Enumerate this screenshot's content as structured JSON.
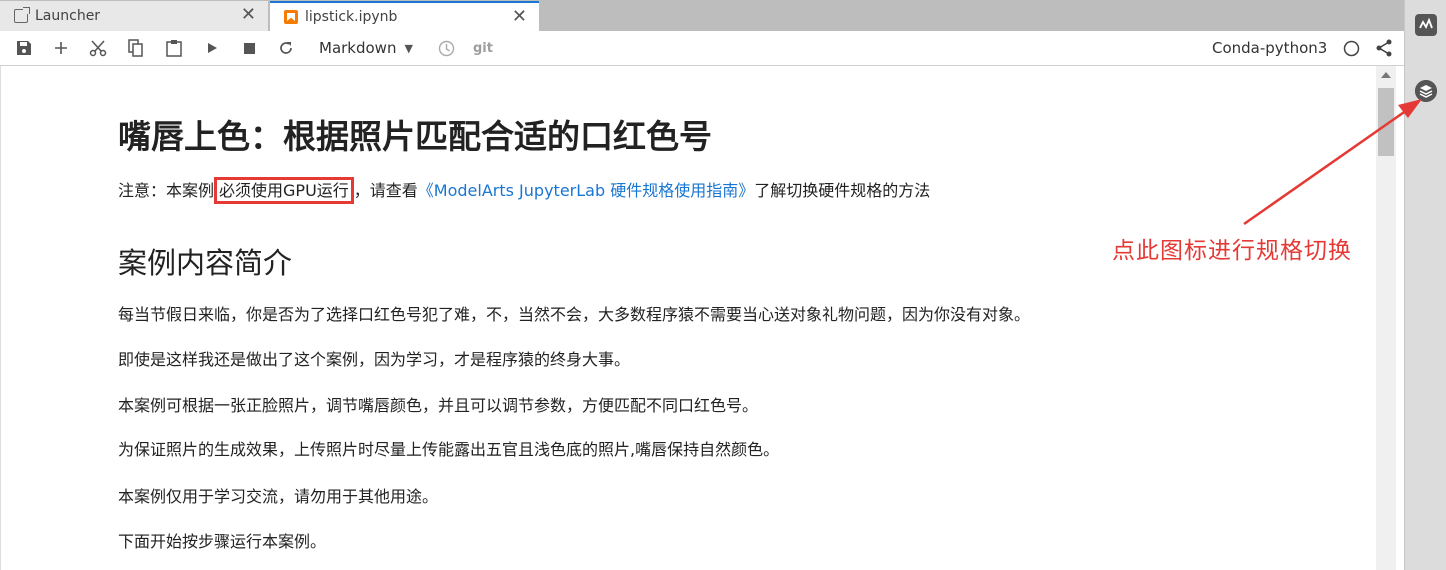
{
  "tabs": [
    {
      "label": "Launcher",
      "icon": "launcher-icon"
    },
    {
      "label": "lipstick.ipynb",
      "icon": "notebook-icon",
      "active": true
    }
  ],
  "toolbar": {
    "cell_type": "Markdown",
    "git_label": "git",
    "kernel": "Conda-python3"
  },
  "notebook": {
    "title": "嘴唇上色：根据照片匹配合适的口红色号",
    "note": {
      "prefix": "注意：本案例",
      "highlight": "必须使用GPU运行",
      "middle": "，请查看",
      "link": "《ModelArts JupyterLab 硬件规格使用指南》",
      "suffix": "了解切换硬件规格的方法"
    },
    "section_title": "案例内容简介",
    "paragraphs": [
      "每当节假日来临，你是否为了选择口红色号犯了难，不，当然不会，大多数程序猿不需要当心送对象礼物问题，因为你没有对象。",
      "即使是这样我还是做出了这个案例，因为学习，才是程序猿的终身大事。",
      "本案例可根据一张正脸照片，调节嘴唇颜色，并且可以调节参数，方便匹配不同口红色号。",
      "为保证照片的生成效果，上传照片时尽量上传能露出五官且浅色底的照片,嘴唇保持自然颜色。",
      "本案例仅用于学习交流，请勿用于其他用途。",
      "下面开始按步骤运行本案例。"
    ]
  },
  "annotation": "点此图标进行规格切换",
  "colors": {
    "accent": "#1976d2",
    "annotation": "#e53935",
    "notebook_icon": "#f57c00"
  }
}
